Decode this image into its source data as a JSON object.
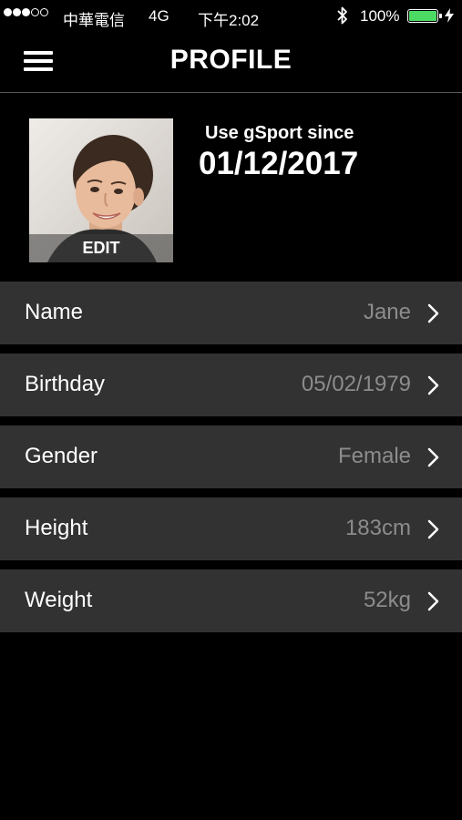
{
  "status_bar": {
    "carrier": "中華電信",
    "network": "4G",
    "time": "下午2:02",
    "battery_percent": "100%",
    "battery_color": "#4cd964",
    "icons": [
      "signal-dots-icon",
      "bluetooth-icon",
      "battery-icon",
      "charging-bolt-icon"
    ]
  },
  "header": {
    "title": "PROFILE",
    "menu_icon": "hamburger-menu-icon"
  },
  "profile": {
    "avatar_edit_label": "EDIT",
    "since_label": "Use gSport since",
    "since_date": "01/12/2017"
  },
  "fields": [
    {
      "label": "Name",
      "value": "Jane"
    },
    {
      "label": "Birthday",
      "value": "05/02/1979"
    },
    {
      "label": "Gender",
      "value": "Female"
    },
    {
      "label": "Height",
      "value": "183cm"
    },
    {
      "label": "Weight",
      "value": "52kg"
    }
  ],
  "colors": {
    "background": "#000000",
    "row_background": "#323232",
    "value_text": "#8c8c8c"
  }
}
